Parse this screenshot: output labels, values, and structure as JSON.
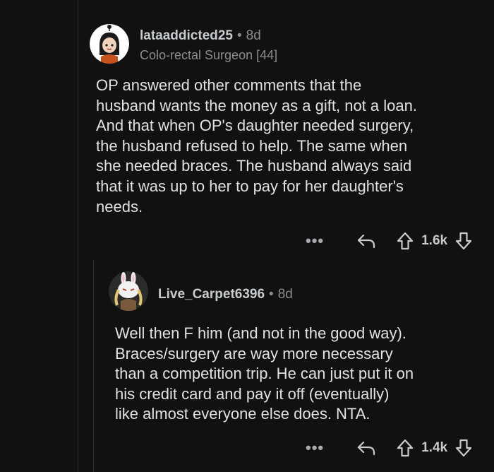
{
  "comments": [
    {
      "username": "lataaddicted25",
      "age": "8d",
      "flair": "Colo-rectal Surgeon [44]",
      "body": "OP answered other comments that the\nhusband wants the money as a gift, not a loan.\nAnd that when OP's daughter needed surgery,\nthe husband refused to help. The same when\nshe needed braces. The husband always said\nthat it was up to her to pay for her daughter's\nneeds.",
      "score": "1.6k"
    },
    {
      "username": "Live_Carpet6396",
      "age": "8d",
      "body": "Well then F him (and not in the good way).\nBraces/surgery are way more necessary\nthan a competition trip. He can just put it on\nhis credit card and pay it off (eventually)\nlike almost everyone else does. NTA.",
      "score": "1.4k"
    }
  ],
  "ui": {
    "separator": "•",
    "more_label": "•••",
    "icons": [
      "more-icon",
      "reply-icon",
      "upvote-icon",
      "downvote-icon"
    ]
  },
  "colors": {
    "background": "#111112",
    "thread_line": "#2b2c2e",
    "text": "#dfe1e3",
    "muted": "#8a8d90"
  }
}
